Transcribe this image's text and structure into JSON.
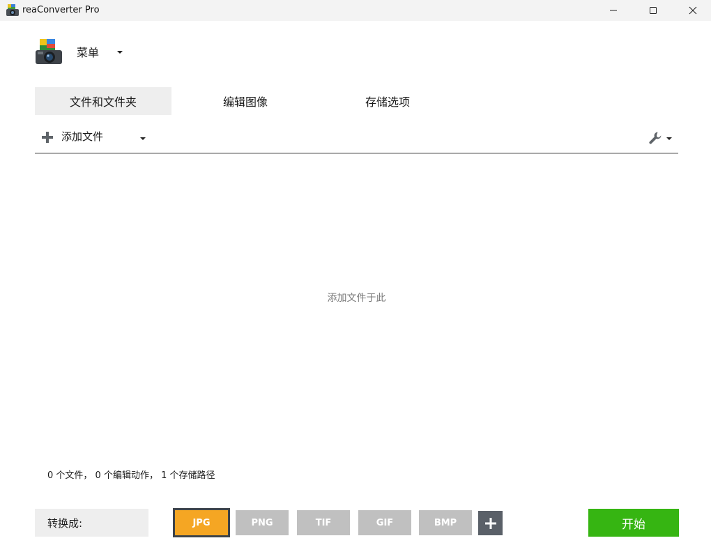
{
  "window": {
    "title": "reaConverter Pro",
    "icon": "app-camera-icon",
    "controls": [
      "minimize-icon",
      "maximize-icon",
      "close-icon"
    ]
  },
  "menu": {
    "label": "菜单",
    "icon": "app-camera-icon"
  },
  "tabs": [
    {
      "label": "文件和文件夹",
      "active": true
    },
    {
      "label": "编辑图像",
      "active": false
    },
    {
      "label": "存储选项",
      "active": false
    }
  ],
  "toolbar": {
    "add_files_label": "添加文件",
    "add_icon": "plus-icon",
    "settings_icon": "wrench-icon"
  },
  "drop_zone": {
    "hint": "添加文件于此"
  },
  "status": {
    "text": "0 个文件， 0 个编辑动作， 1 个存储路径"
  },
  "bottom": {
    "convert_label": "转换成:",
    "formats": [
      {
        "label": "JPG",
        "selected": true
      },
      {
        "label": "PNG",
        "selected": false
      },
      {
        "label": "TIF",
        "selected": false
      },
      {
        "label": "GIF",
        "selected": false
      },
      {
        "label": "BMP",
        "selected": false
      }
    ],
    "add_format_icon": "plus-icon",
    "start_label": "开始"
  },
  "colors": {
    "accent_selected_format": "#f5a623",
    "start_button": "#36b512",
    "inactive_format": "#c0c0c0",
    "tab_active_bg": "#eeeeee",
    "title_bar": "#f3f3f3"
  }
}
